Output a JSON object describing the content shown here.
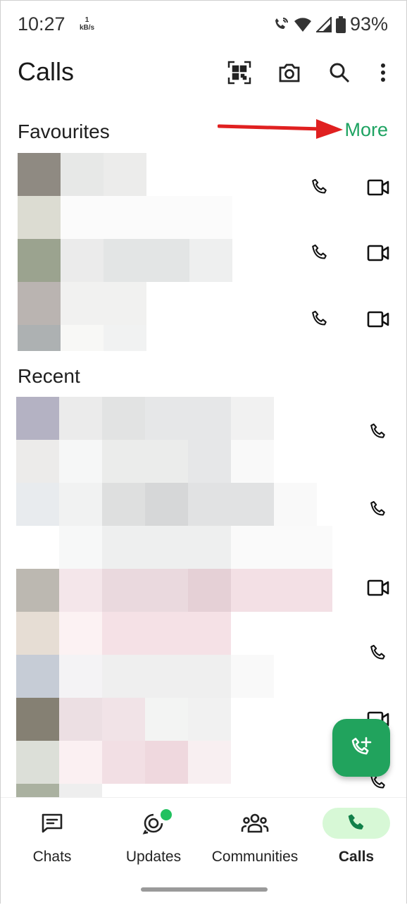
{
  "status": {
    "time": "10:27",
    "net_speed_value": "1",
    "net_speed_unit": "kB/s",
    "battery": "93%"
  },
  "header": {
    "title": "Calls"
  },
  "favourites": {
    "title": "Favourites",
    "more_label": "More"
  },
  "recent": {
    "title": "Recent"
  },
  "nav": {
    "items": [
      {
        "label": "Chats"
      },
      {
        "label": "Updates"
      },
      {
        "label": "Communities"
      },
      {
        "label": "Calls"
      }
    ]
  },
  "colors": {
    "accent": "#1ea362",
    "fab": "#21a35d",
    "active_pill": "#d7f8d6",
    "arrow": "#e02020"
  }
}
